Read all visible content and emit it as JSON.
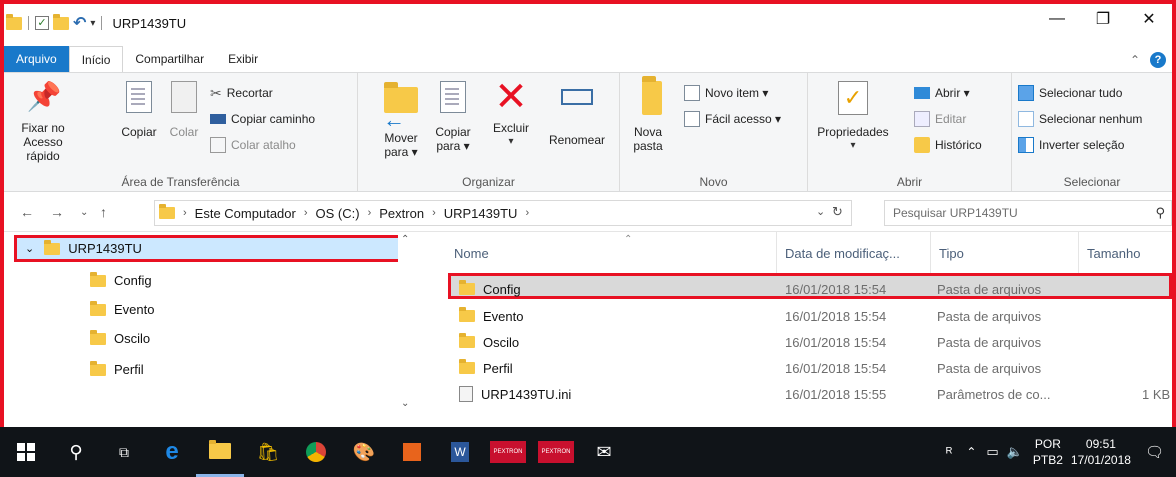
{
  "window": {
    "title": "URP1439TU",
    "controls": [
      "—",
      "❐",
      "✕"
    ]
  },
  "tabs": {
    "file": "Arquivo",
    "home": "Início",
    "share": "Compartilhar",
    "view": "Exibir"
  },
  "ribbon": {
    "clipboard": {
      "group_label": "Área de Transferência",
      "pin": "Fixar no Acesso rápido",
      "copy": "Copiar",
      "paste": "Colar",
      "cut": "Recortar",
      "copy_path": "Copiar caminho",
      "paste_shortcut": "Colar atalho"
    },
    "organize": {
      "group_label": "Organizar",
      "move_to": "Mover para ▾",
      "copy_to": "Copiar para ▾",
      "delete": "Excluir",
      "rename": "Renomear"
    },
    "new": {
      "group_label": "Novo",
      "new_folder": "Nova pasta",
      "new_item": "Novo item ▾",
      "easy_access": "Fácil acesso ▾"
    },
    "open": {
      "group_label": "Abrir",
      "properties": "Propriedades",
      "open": "Abrir ▾",
      "edit": "Editar",
      "history": "Histórico"
    },
    "select": {
      "group_label": "Selecionar",
      "select_all": "Selecionar tudo",
      "select_none": "Selecionar nenhum",
      "invert": "Inverter seleção"
    }
  },
  "address": {
    "crumbs": [
      "Este Computador",
      "OS (C:)",
      "Pextron",
      "URP1439TU"
    ],
    "search_placeholder": "Pesquisar URP1439TU"
  },
  "tree": {
    "root": "URP1439TU",
    "children": [
      "Config",
      "Evento",
      "Oscilo",
      "Perfil"
    ]
  },
  "list": {
    "headers": {
      "name": "Nome",
      "date": "Data de modificaç...",
      "type": "Tipo",
      "size": "Tamanho"
    },
    "rows": [
      {
        "name": "Config",
        "date": "16/01/2018 15:54",
        "type": "Pasta de arquivos",
        "size": ""
      },
      {
        "name": "Evento",
        "date": "16/01/2018 15:54",
        "type": "Pasta de arquivos",
        "size": ""
      },
      {
        "name": "Oscilo",
        "date": "16/01/2018 15:54",
        "type": "Pasta de arquivos",
        "size": ""
      },
      {
        "name": "Perfil",
        "date": "16/01/2018 15:54",
        "type": "Pasta de arquivos",
        "size": ""
      },
      {
        "name": "URP1439TU.ini",
        "date": "16/01/2018 15:55",
        "type": "Parâmetros de co...",
        "size": "1 KB"
      }
    ]
  },
  "taskbar": {
    "lang_top": "POR",
    "lang_bottom": "PTB2",
    "time": "09:51",
    "date": "17/01/2018",
    "app_label": "PEXTRON"
  }
}
